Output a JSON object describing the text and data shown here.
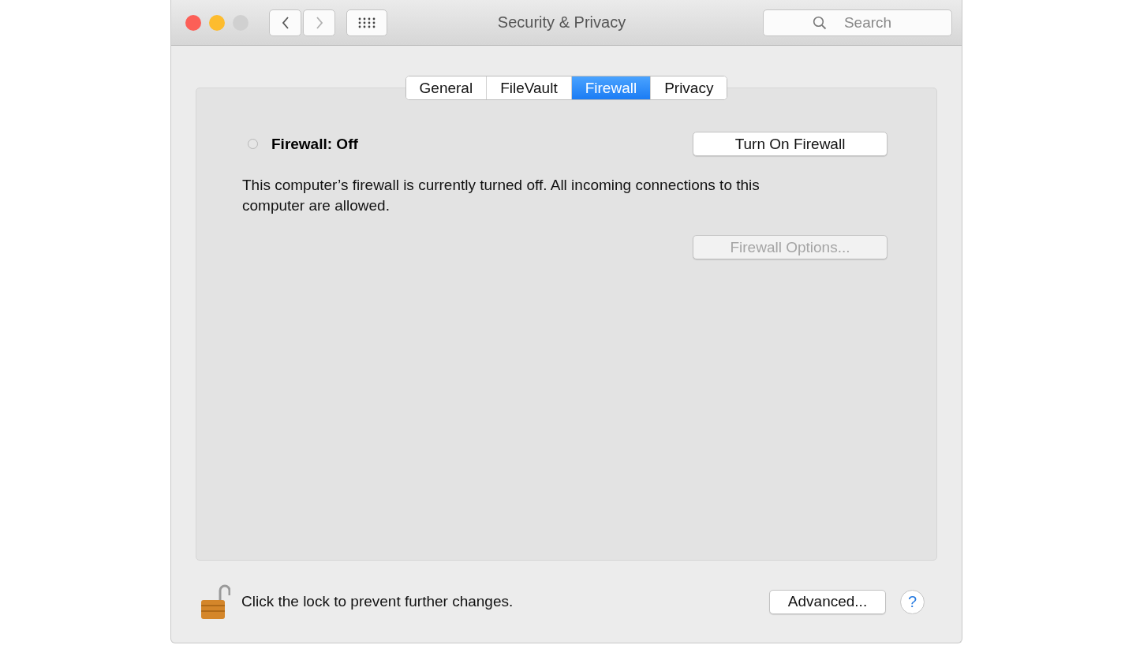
{
  "window": {
    "title": "Security & Privacy",
    "controls": [
      {
        "kind": "close",
        "disabled": false
      },
      {
        "kind": "minimize",
        "disabled": false
      },
      {
        "kind": "zoom",
        "disabled": true
      }
    ]
  },
  "navigation": {
    "back_disabled": false,
    "forward_disabled": true
  },
  "search": {
    "placeholder": "Search"
  },
  "tabs": [
    {
      "label": "General",
      "selected": false
    },
    {
      "label": "FileVault",
      "selected": false
    },
    {
      "label": "Firewall",
      "selected": true
    },
    {
      "label": "Privacy",
      "selected": false
    }
  ],
  "firewall": {
    "status": "Firewall: Off",
    "on": false,
    "toggle_button": "Turn On Firewall",
    "description": "This computer’s firewall is currently turned off. All incoming connections to this computer are allowed.",
    "options_button": {
      "label": "Firewall Options...",
      "disabled": true
    }
  },
  "footer": {
    "locked": false,
    "lock_text": "Click the lock to prevent further changes.",
    "advanced_button": "Advanced...",
    "help_button": "?"
  }
}
